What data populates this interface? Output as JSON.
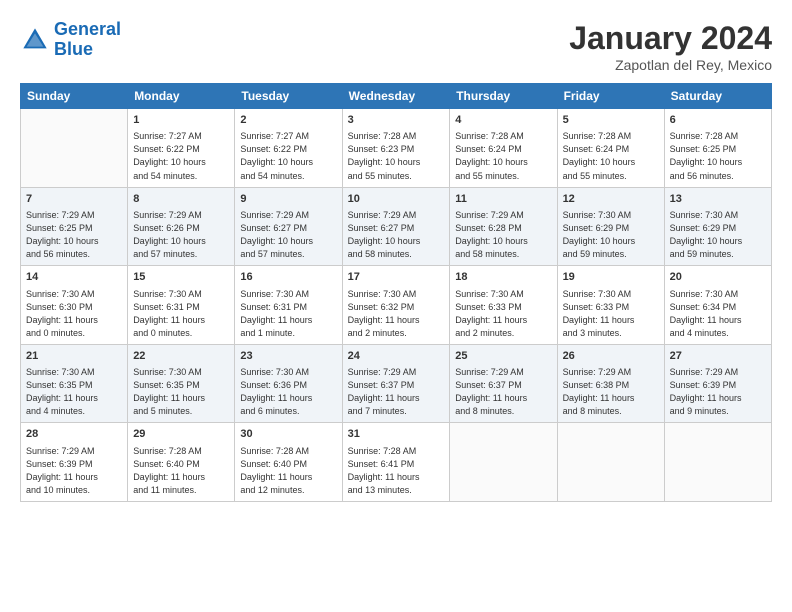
{
  "logo": {
    "line1": "General",
    "line2": "Blue"
  },
  "title": "January 2024",
  "location": "Zapotlan del Rey, Mexico",
  "headers": [
    "Sunday",
    "Monday",
    "Tuesday",
    "Wednesday",
    "Thursday",
    "Friday",
    "Saturday"
  ],
  "weeks": [
    [
      {
        "day": "",
        "info": ""
      },
      {
        "day": "1",
        "info": "Sunrise: 7:27 AM\nSunset: 6:22 PM\nDaylight: 10 hours\nand 54 minutes."
      },
      {
        "day": "2",
        "info": "Sunrise: 7:27 AM\nSunset: 6:22 PM\nDaylight: 10 hours\nand 54 minutes."
      },
      {
        "day": "3",
        "info": "Sunrise: 7:28 AM\nSunset: 6:23 PM\nDaylight: 10 hours\nand 55 minutes."
      },
      {
        "day": "4",
        "info": "Sunrise: 7:28 AM\nSunset: 6:24 PM\nDaylight: 10 hours\nand 55 minutes."
      },
      {
        "day": "5",
        "info": "Sunrise: 7:28 AM\nSunset: 6:24 PM\nDaylight: 10 hours\nand 55 minutes."
      },
      {
        "day": "6",
        "info": "Sunrise: 7:28 AM\nSunset: 6:25 PM\nDaylight: 10 hours\nand 56 minutes."
      }
    ],
    [
      {
        "day": "7",
        "info": "Sunrise: 7:29 AM\nSunset: 6:25 PM\nDaylight: 10 hours\nand 56 minutes."
      },
      {
        "day": "8",
        "info": "Sunrise: 7:29 AM\nSunset: 6:26 PM\nDaylight: 10 hours\nand 57 minutes."
      },
      {
        "day": "9",
        "info": "Sunrise: 7:29 AM\nSunset: 6:27 PM\nDaylight: 10 hours\nand 57 minutes."
      },
      {
        "day": "10",
        "info": "Sunrise: 7:29 AM\nSunset: 6:27 PM\nDaylight: 10 hours\nand 58 minutes."
      },
      {
        "day": "11",
        "info": "Sunrise: 7:29 AM\nSunset: 6:28 PM\nDaylight: 10 hours\nand 58 minutes."
      },
      {
        "day": "12",
        "info": "Sunrise: 7:30 AM\nSunset: 6:29 PM\nDaylight: 10 hours\nand 59 minutes."
      },
      {
        "day": "13",
        "info": "Sunrise: 7:30 AM\nSunset: 6:29 PM\nDaylight: 10 hours\nand 59 minutes."
      }
    ],
    [
      {
        "day": "14",
        "info": "Sunrise: 7:30 AM\nSunset: 6:30 PM\nDaylight: 11 hours\nand 0 minutes."
      },
      {
        "day": "15",
        "info": "Sunrise: 7:30 AM\nSunset: 6:31 PM\nDaylight: 11 hours\nand 0 minutes."
      },
      {
        "day": "16",
        "info": "Sunrise: 7:30 AM\nSunset: 6:31 PM\nDaylight: 11 hours\nand 1 minute."
      },
      {
        "day": "17",
        "info": "Sunrise: 7:30 AM\nSunset: 6:32 PM\nDaylight: 11 hours\nand 2 minutes."
      },
      {
        "day": "18",
        "info": "Sunrise: 7:30 AM\nSunset: 6:33 PM\nDaylight: 11 hours\nand 2 minutes."
      },
      {
        "day": "19",
        "info": "Sunrise: 7:30 AM\nSunset: 6:33 PM\nDaylight: 11 hours\nand 3 minutes."
      },
      {
        "day": "20",
        "info": "Sunrise: 7:30 AM\nSunset: 6:34 PM\nDaylight: 11 hours\nand 4 minutes."
      }
    ],
    [
      {
        "day": "21",
        "info": "Sunrise: 7:30 AM\nSunset: 6:35 PM\nDaylight: 11 hours\nand 4 minutes."
      },
      {
        "day": "22",
        "info": "Sunrise: 7:30 AM\nSunset: 6:35 PM\nDaylight: 11 hours\nand 5 minutes."
      },
      {
        "day": "23",
        "info": "Sunrise: 7:30 AM\nSunset: 6:36 PM\nDaylight: 11 hours\nand 6 minutes."
      },
      {
        "day": "24",
        "info": "Sunrise: 7:29 AM\nSunset: 6:37 PM\nDaylight: 11 hours\nand 7 minutes."
      },
      {
        "day": "25",
        "info": "Sunrise: 7:29 AM\nSunset: 6:37 PM\nDaylight: 11 hours\nand 8 minutes."
      },
      {
        "day": "26",
        "info": "Sunrise: 7:29 AM\nSunset: 6:38 PM\nDaylight: 11 hours\nand 8 minutes."
      },
      {
        "day": "27",
        "info": "Sunrise: 7:29 AM\nSunset: 6:39 PM\nDaylight: 11 hours\nand 9 minutes."
      }
    ],
    [
      {
        "day": "28",
        "info": "Sunrise: 7:29 AM\nSunset: 6:39 PM\nDaylight: 11 hours\nand 10 minutes."
      },
      {
        "day": "29",
        "info": "Sunrise: 7:28 AM\nSunset: 6:40 PM\nDaylight: 11 hours\nand 11 minutes."
      },
      {
        "day": "30",
        "info": "Sunrise: 7:28 AM\nSunset: 6:40 PM\nDaylight: 11 hours\nand 12 minutes."
      },
      {
        "day": "31",
        "info": "Sunrise: 7:28 AM\nSunset: 6:41 PM\nDaylight: 11 hours\nand 13 minutes."
      },
      {
        "day": "",
        "info": ""
      },
      {
        "day": "",
        "info": ""
      },
      {
        "day": "",
        "info": ""
      }
    ]
  ]
}
